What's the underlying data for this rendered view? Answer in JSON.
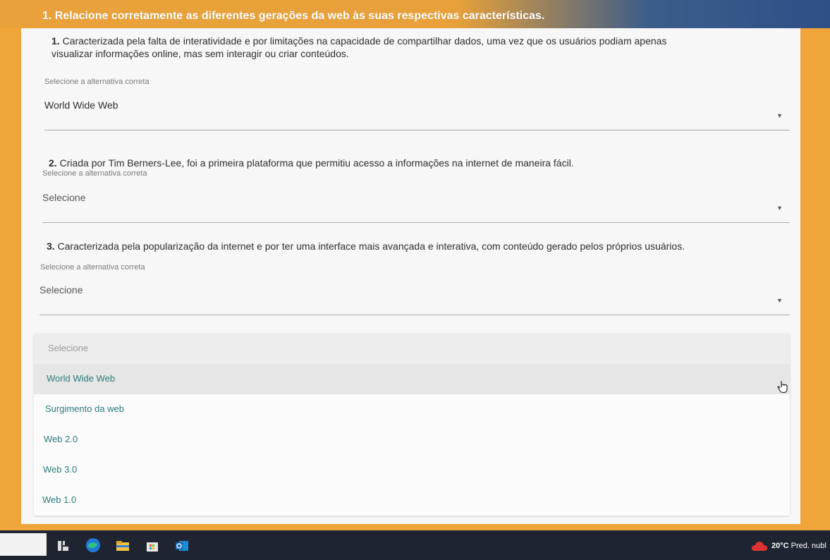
{
  "page": {
    "heading": "1. Relacione corretamente as diferentes gerações da web às suas respectivas características."
  },
  "questions": [
    {
      "number": "1.",
      "text": "Caracterizada pela falta de interatividade e por limitações na capacidade de compartilhar dados, uma vez que os usuários podiam apenas",
      "text_line2": "visualizar informações online, mas sem interagir ou criar conteúdos.",
      "help": "Selecione a alternativa correta",
      "selected": "World Wide Web"
    },
    {
      "number": "2.",
      "text": "Criada por Tim Berners-Lee, foi a primeira plataforma que permitiu acesso a informações na internet de maneira fácil.",
      "help": "Selecione a alternativa correta",
      "selected": "Selecione"
    },
    {
      "number": "3.",
      "text": "Caracterizada pela popularização da internet e por ter uma interface mais avançada e interativa, com conteúdo gerado pelos próprios usuários.",
      "help": "Selecione a alternativa correta",
      "selected": "Selecione"
    }
  ],
  "dropdown": {
    "placeholder": "Selecione",
    "options": [
      "World Wide Web",
      "Surgimento da web",
      "Web 2.0",
      "Web 3.0",
      "Web 1.0"
    ]
  },
  "taskbar": {
    "weather_temp": "20°C",
    "weather_text": "Pred. nubl"
  },
  "colors": {
    "background": "#f0a53a",
    "option_text": "#2a7a7a",
    "taskbar": "#1f2530"
  },
  "icons": [
    "caret-down-icon",
    "hand-cursor-icon",
    "task-view-icon",
    "edge-icon",
    "file-explorer-icon",
    "store-icon",
    "outlook-icon",
    "weather-icon"
  ]
}
